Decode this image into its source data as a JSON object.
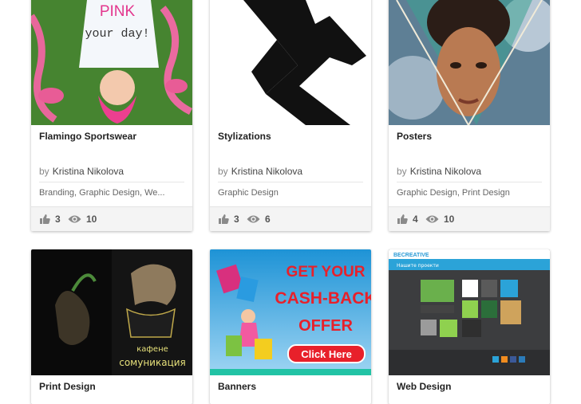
{
  "projects": [
    {
      "title": "Flamingo Sportswear",
      "by": "by",
      "author": "Kristina Nikolova",
      "tags": "Branding, Graphic Design, We...",
      "likes": "3",
      "views": "10",
      "art_text_1": "PINK",
      "art_text_2": "your day!"
    },
    {
      "title": "Stylizations",
      "by": "by",
      "author": "Kristina Nikolova",
      "tags": "Graphic Design",
      "likes": "3",
      "views": "6"
    },
    {
      "title": "Posters",
      "by": "by",
      "author": "Kristina Nikolova",
      "tags": "Graphic Design, Print Design",
      "likes": "4",
      "views": "10"
    },
    {
      "title": "Print Design",
      "art_text_1": "кафене",
      "art_text_2": "сомуникация"
    },
    {
      "title": "Banners",
      "art_text_1": "GET YOUR",
      "art_text_2": "CASH-BACK",
      "art_text_3": "OFFER",
      "art_text_4": "Click Here"
    },
    {
      "title": "Web Design",
      "art_text_1": "BECREATIVE",
      "art_text_2": "Нашите проекти"
    }
  ],
  "colors": {
    "card_bg": "#ffffff",
    "stats_bg": "#f4f4f4",
    "icon": "#8a8a8a",
    "banner_red": "#e8202a"
  },
  "icons": {
    "likes": "thumbs-up-icon",
    "views": "eye-icon"
  }
}
